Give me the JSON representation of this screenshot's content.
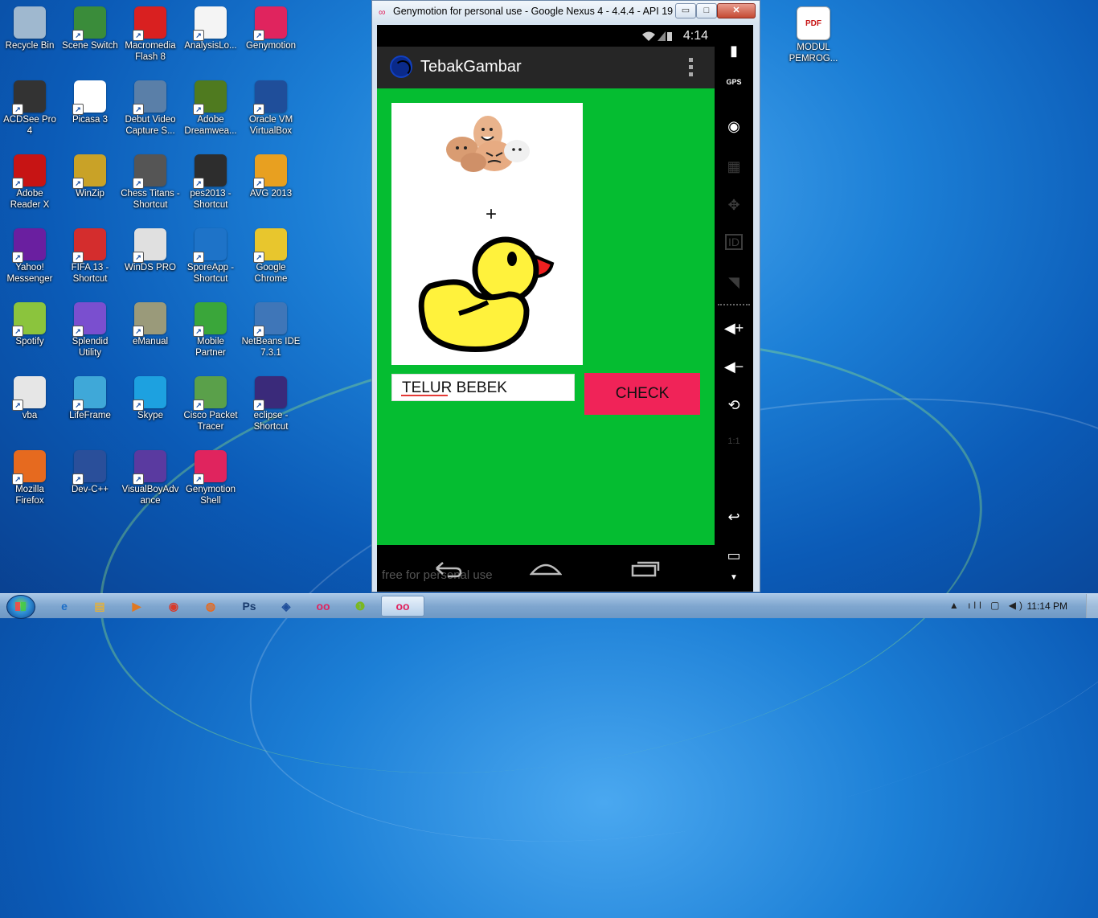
{
  "desktop": {
    "icons": [
      {
        "label": "Recycle Bin",
        "icon": "recycle-bin-icon",
        "color": "#9fb8cf"
      },
      {
        "label": "Scene Switch",
        "icon": "scene-switch-icon",
        "color": "#3a8c3a"
      },
      {
        "label": "Macromedia Flash 8",
        "icon": "flash-icon",
        "color": "#d92020"
      },
      {
        "label": "AnalysisLo...",
        "icon": "document-icon",
        "color": "#f4f4f4"
      },
      {
        "label": "Genymotion",
        "icon": "genymotion-icon",
        "color": "#e0245e"
      },
      {
        "label": "ACDSee Pro 4",
        "icon": "camera-icon",
        "color": "#333333"
      },
      {
        "label": "Picasa 3",
        "icon": "picasa-icon",
        "color": "#ffffff"
      },
      {
        "label": "Debut Video Capture S...",
        "icon": "debut-icon",
        "color": "#5a7fa8"
      },
      {
        "label": "Adobe Dreamwea...",
        "icon": "dreamweaver-icon",
        "color": "#4f7a1f"
      },
      {
        "label": "Oracle VM VirtualBox",
        "icon": "virtualbox-icon",
        "color": "#1f4e9a"
      },
      {
        "label": "Adobe Reader X",
        "icon": "acrobat-icon",
        "color": "#c71414"
      },
      {
        "label": "WinZip",
        "icon": "winzip-icon",
        "color": "#c9a227"
      },
      {
        "label": "Chess Titans - Shortcut",
        "icon": "chess-icon",
        "color": "#555555"
      },
      {
        "label": "pes2013 - Shortcut",
        "icon": "pes-icon",
        "color": "#2d2d2d"
      },
      {
        "label": "AVG 2013",
        "icon": "avg-icon",
        "color": "#e8a020"
      },
      {
        "label": "Yahoo! Messenger",
        "icon": "yahoo-icon",
        "color": "#6a1fa0"
      },
      {
        "label": "FIFA 13 - Shortcut",
        "icon": "fifa-icon",
        "color": "#d42d2d"
      },
      {
        "label": "WinDS PRO",
        "icon": "nintendo-ds-icon",
        "color": "#e0e0e0"
      },
      {
        "label": "SporeApp - Shortcut",
        "icon": "spore-icon",
        "color": "#1e73c8"
      },
      {
        "label": "Google Chrome",
        "icon": "chrome-icon",
        "color": "#e8c62d"
      },
      {
        "label": "Spotify",
        "icon": "spotify-icon",
        "color": "#8bc43d"
      },
      {
        "label": "Splendid Utility",
        "icon": "splendid-icon",
        "color": "#7a4fcf"
      },
      {
        "label": "eManual",
        "icon": "manual-icon",
        "color": "#9a9a7a"
      },
      {
        "label": "Mobile Partner",
        "icon": "mobile-partner-icon",
        "color": "#3aa63a"
      },
      {
        "label": "NetBeans IDE 7.3.1",
        "icon": "netbeans-icon",
        "color": "#3f76b8"
      },
      {
        "label": "vba",
        "icon": "settings-file-icon",
        "color": "#e6e6e6"
      },
      {
        "label": "LifeFrame",
        "icon": "lifeframe-icon",
        "color": "#3fa8d8"
      },
      {
        "label": "Skype",
        "icon": "skype-icon",
        "color": "#1da1e0"
      },
      {
        "label": "Cisco Packet Tracer",
        "icon": "cisco-icon",
        "color": "#5aa04a"
      },
      {
        "label": "eclipse - Shortcut",
        "icon": "eclipse-icon",
        "color": "#3a2a7a"
      },
      {
        "label": "Mozilla Firefox",
        "icon": "firefox-icon",
        "color": "#e66a1f"
      },
      {
        "label": "Dev-C++",
        "icon": "devcpp-icon",
        "color": "#2a4f9a"
      },
      {
        "label": "VisualBoyAdvance",
        "icon": "gameboy-icon",
        "color": "#5a3aa0"
      },
      {
        "label": "Genymotion Shell",
        "icon": "genymotion-shell-icon",
        "color": "#e0245e"
      }
    ],
    "right_icon": {
      "label": "MODUL PEMROG...",
      "icon": "pdf-icon",
      "badge": "PDF",
      "color": "#ffffff"
    }
  },
  "window": {
    "title": "Genymotion for personal use - Google Nexus 4 - 4.4.4 - API 19 ...",
    "min_label": "▭",
    "max_label": "□",
    "close_label": "✕"
  },
  "phone": {
    "status_time": "4:14",
    "app_title": "TebakGambar",
    "plus_sign": "+",
    "answer_value": "TELUR BEBEK",
    "check_label": "CHECK",
    "watermark": "free for personal use"
  },
  "sidebar": {
    "gps_label": "GPS",
    "id_label": "ID",
    "ratio_label": "1:1"
  },
  "taskbar": {
    "clock": "11:14 PM",
    "items": [
      {
        "icon": "ie-icon",
        "glyph": "e",
        "color": "#1e6fc8"
      },
      {
        "icon": "explorer-icon",
        "glyph": "▤",
        "color": "#e0b040"
      },
      {
        "icon": "media-player-icon",
        "glyph": "▶",
        "color": "#e07820"
      },
      {
        "icon": "chrome-icon",
        "glyph": "◉",
        "color": "#d83a2a"
      },
      {
        "icon": "firefox-icon",
        "glyph": "◍",
        "color": "#e66a1f"
      },
      {
        "icon": "photoshop-icon",
        "glyph": "Ps",
        "color": "#1a3c6e"
      },
      {
        "icon": "virtualbox-icon",
        "glyph": "◈",
        "color": "#1f4e9a"
      },
      {
        "icon": "genymotion-icon",
        "glyph": "oo",
        "color": "#e0245e"
      },
      {
        "icon": "android-tool-icon",
        "glyph": "❶",
        "color": "#7ab820"
      },
      {
        "icon": "genymotion-player-icon",
        "glyph": "oo",
        "color": "#e0245e"
      }
    ]
  }
}
